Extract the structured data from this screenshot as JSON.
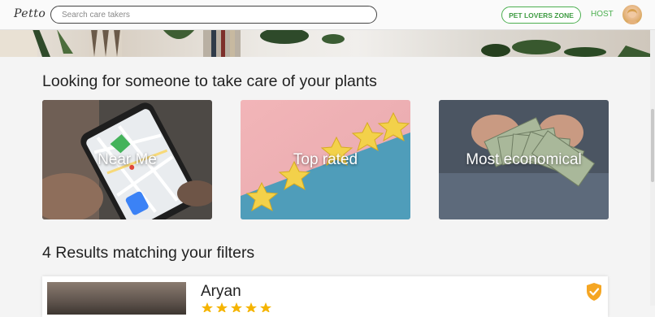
{
  "navbar": {
    "logo": "Petto",
    "search_placeholder": "Search care takers",
    "zone_button": "PET LOVERS ZONE",
    "host_link": "HOST"
  },
  "section": {
    "title": "Looking for someone to take care of your plants",
    "categories": [
      {
        "label": "Near Me",
        "icon": "map-phone-image"
      },
      {
        "label": "Top rated",
        "icon": "stars-image"
      },
      {
        "label": "Most economical",
        "icon": "money-image"
      }
    ]
  },
  "results": {
    "title": "4 Results matching your filters",
    "items": [
      {
        "name": "Aryan",
        "rating": 5,
        "verified": true
      }
    ]
  },
  "colors": {
    "accent": "#4caf50",
    "verified_badge": "#f5a623"
  }
}
